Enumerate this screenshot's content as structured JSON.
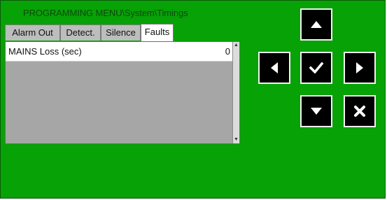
{
  "menu": {
    "title": "PROGRAMMING MENU\\System\\Timings"
  },
  "tabs": [
    {
      "label": "Alarm Out",
      "active": false
    },
    {
      "label": "Detect.",
      "active": false
    },
    {
      "label": "Silence",
      "active": false
    },
    {
      "label": "Faults",
      "active": true
    }
  ],
  "rows": [
    {
      "label": "MAINS Loss (sec)",
      "value": "0"
    }
  ],
  "nav_buttons": {
    "up": "arrow-up-icon",
    "left": "arrow-left-icon",
    "confirm": "checkmark-icon",
    "right": "arrow-right-icon",
    "down": "arrow-down-icon",
    "cancel": "cancel-x-icon"
  },
  "colors": {
    "background": "#07a206",
    "title_text": "#0c4a0c",
    "panel": "#a6a6a6",
    "button": "#000000"
  }
}
